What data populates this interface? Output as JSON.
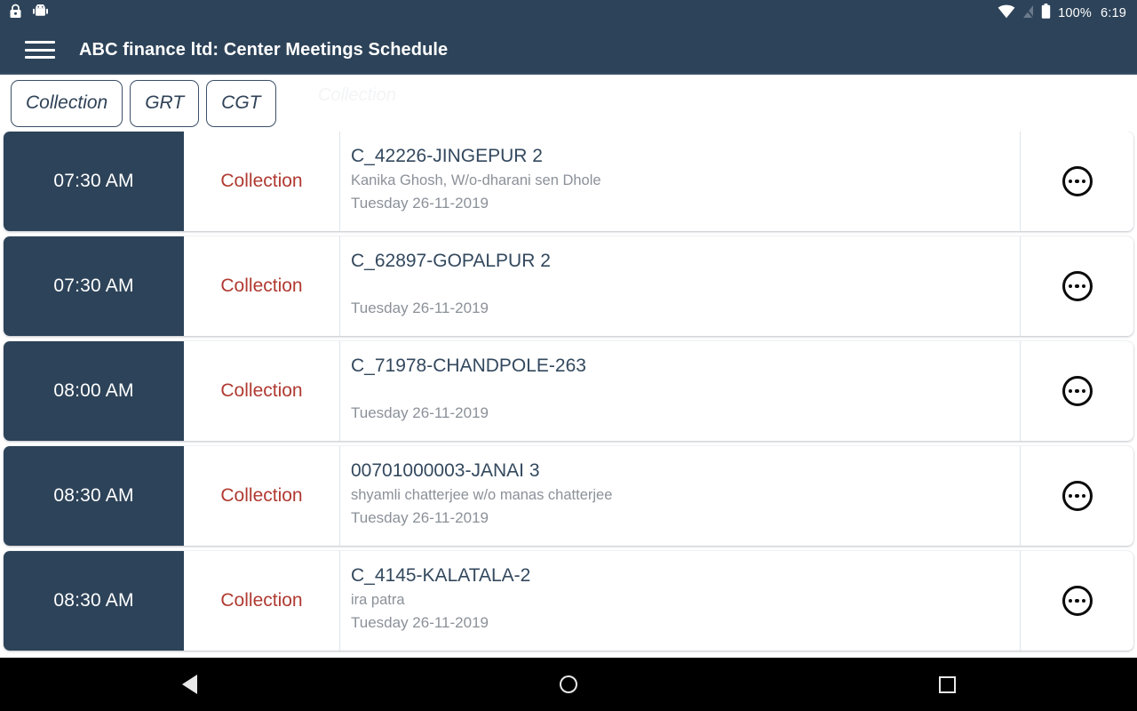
{
  "statusbar": {
    "left_icons": [
      "lock-icon",
      "android-robot-icon"
    ],
    "wifi_icon": "wifi-icon",
    "signal_icon": "no-signal-icon",
    "battery_icon": "battery-full-icon",
    "battery_text": "100%",
    "time": "6:19",
    "background_color": "#2d4359"
  },
  "appbar": {
    "menu_icon": "hamburger-menu-icon",
    "title": "ABC finance ltd: Center Meetings Schedule",
    "background_color": "#2d4359",
    "text_color": "#ffffff"
  },
  "tabs": {
    "ghost_label": "Collection",
    "items": [
      {
        "label": "Collection"
      },
      {
        "label": "GRT"
      },
      {
        "label": "CGT"
      }
    ]
  },
  "list": {
    "action_icon": "more-options-icon",
    "time_block_color": "#2d4359",
    "type_text_color": "#b03a31",
    "rows": [
      {
        "time": "07:30 AM",
        "type": "Collection",
        "title": "C_42226-JINGEPUR 2",
        "subtitle": "Kanika Ghosh, W/o-dharani  sen Dhole",
        "date": "Tuesday 26-11-2019"
      },
      {
        "time": "07:30 AM",
        "type": "Collection",
        "title": "C_62897-GOPALPUR 2",
        "subtitle": "",
        "date": "Tuesday 26-11-2019"
      },
      {
        "time": "08:00 AM",
        "type": "Collection",
        "title": "C_71978-CHANDPOLE-263",
        "subtitle": "",
        "date": "Tuesday 26-11-2019"
      },
      {
        "time": "08:30 AM",
        "type": "Collection",
        "title": "00701000003-JANAI 3",
        "subtitle": "shyamli chatterjee w/o manas chatterjee",
        "date": "Tuesday 26-11-2019"
      },
      {
        "time": "08:30 AM",
        "type": "Collection",
        "title": "C_4145-KALATALA-2",
        "subtitle": "ira patra",
        "date": "Tuesday 26-11-2019"
      }
    ]
  },
  "navbar": {
    "back_icon": "back-triangle-icon",
    "home_icon": "home-circle-icon",
    "recents_icon": "recents-square-icon",
    "background_color": "#000000"
  }
}
